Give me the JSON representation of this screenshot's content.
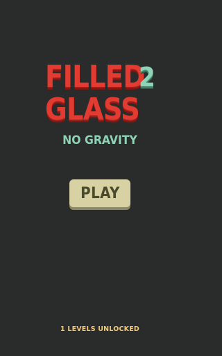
{
  "title": {
    "line1": "FILLED",
    "number": "2",
    "line2": "GLASS",
    "subtitle": "NO GRAVITY"
  },
  "play_button": {
    "label": "PLAY"
  },
  "footer": {
    "status": "1 LEVELS UNLOCKED"
  },
  "colors": {
    "background": "#2a2b2b",
    "title_red": "#e23b32",
    "accent_mint": "#8fd3b6",
    "button_bg": "#d8d1a4",
    "footer_text": "#f2c879"
  }
}
